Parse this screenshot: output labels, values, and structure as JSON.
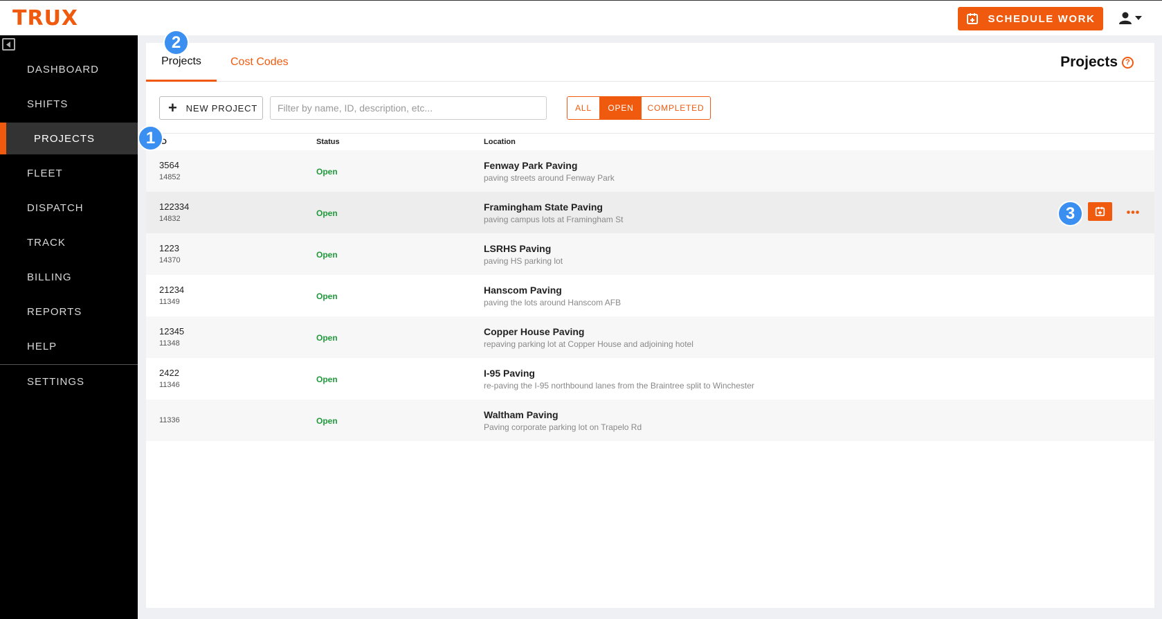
{
  "app": {
    "logo": "TRUX"
  },
  "header": {
    "schedule_label": "SCHEDULE WORK",
    "user_icon": "user-icon"
  },
  "sidebar": {
    "items": [
      {
        "label": "DASHBOARD"
      },
      {
        "label": "SHIFTS"
      },
      {
        "label": "PROJECTS",
        "active": true
      },
      {
        "label": "FLEET"
      },
      {
        "label": "DISPATCH"
      },
      {
        "label": "TRACK"
      },
      {
        "label": "BILLING"
      },
      {
        "label": "REPORTS"
      },
      {
        "label": "HELP"
      },
      {
        "label": "SETTINGS"
      }
    ]
  },
  "tabs": [
    {
      "label": "Projects",
      "active": true
    },
    {
      "label": "Cost Codes"
    }
  ],
  "page": {
    "title": "Projects",
    "help_icon": "help-icon"
  },
  "toolbar": {
    "new_project_label": "NEW PROJECT",
    "filter_placeholder": "Filter by name, ID, description, etc...",
    "filters": [
      {
        "label": "ALL"
      },
      {
        "label": "OPEN",
        "selected": true
      },
      {
        "label": "COMPLETED"
      }
    ]
  },
  "table": {
    "columns": [
      "ID",
      "Status",
      "Location"
    ],
    "rows": [
      {
        "id": "3564",
        "subid": "14852",
        "status": "Open",
        "name": "Fenway Park Paving",
        "desc": "paving streets around Fenway Park"
      },
      {
        "id": "122334",
        "subid": "14832",
        "status": "Open",
        "name": "Framingham State Paving",
        "desc": "paving campus lots at Framingham St"
      },
      {
        "id": "1223",
        "subid": "14370",
        "status": "Open",
        "name": "LSRHS Paving",
        "desc": "paving HS parking lot"
      },
      {
        "id": "21234",
        "subid": "11349",
        "status": "Open",
        "name": "Hanscom Paving",
        "desc": "paving the lots around Hanscom AFB"
      },
      {
        "id": "12345",
        "subid": "11348",
        "status": "Open",
        "name": "Copper House Paving",
        "desc": "repaving parking lot at Copper House and adjoining hotel"
      },
      {
        "id": "2422",
        "subid": "11346",
        "status": "Open",
        "name": "I-95 Paving",
        "desc": "re-paving the I-95 northbound lanes from the Braintree split to Winchester"
      },
      {
        "id": "",
        "subid": "11336",
        "status": "Open",
        "name": "Waltham Paving",
        "desc": "Paving corporate parking lot on Trapelo Rd"
      }
    ]
  },
  "badges": [
    "1",
    "2",
    "3"
  ],
  "colors": {
    "accent": "#f05a0e",
    "status_open": "#1f9a3b",
    "badge": "#3b8ff0"
  }
}
